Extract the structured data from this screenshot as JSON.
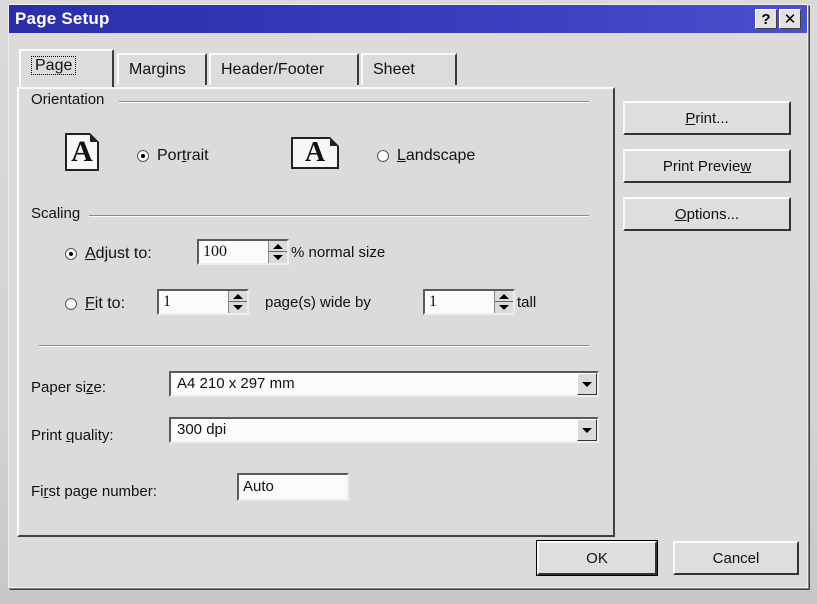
{
  "window": {
    "title": "Page Setup",
    "help_label": "?",
    "close_label": "✕"
  },
  "tabs": [
    {
      "label": "Page",
      "active": true
    },
    {
      "label": "Margins",
      "active": false
    },
    {
      "label": "Header/Footer",
      "active": false
    },
    {
      "label": "Sheet",
      "active": false
    }
  ],
  "orientation": {
    "group_label": "Orientation",
    "portrait_glyph": "A",
    "landscape_glyph": "A",
    "portrait": {
      "label_pre": "Por",
      "label_u": "t",
      "label_post": "rait",
      "checked": true
    },
    "landscape": {
      "label_pre": "",
      "label_u": "L",
      "label_post": "andscape",
      "checked": false
    }
  },
  "scaling": {
    "group_label": "Scaling",
    "adjust": {
      "label_pre": "",
      "label_u": "A",
      "label_post": "djust to:",
      "checked": true,
      "value": "100",
      "suffix": "% normal size"
    },
    "fit": {
      "label_pre": "",
      "label_u": "F",
      "label_post": "it to:",
      "checked": false,
      "wide_value": "1",
      "wide_suffix": "page(s) wide by",
      "tall_value": "1",
      "tall_suffix": "tall"
    }
  },
  "paper_size": {
    "label_pre": "Paper si",
    "label_u": "z",
    "label_post": "e:",
    "value": "A4 210 x 297 mm"
  },
  "print_quality": {
    "label_pre": "Print ",
    "label_u": "q",
    "label_post": "uality:",
    "value": "300 dpi"
  },
  "first_page": {
    "label_pre": "Fi",
    "label_u": "r",
    "label_post": "st page number:",
    "value": "Auto"
  },
  "side_buttons": {
    "print": {
      "pre": "",
      "u": "P",
      "post": "rint..."
    },
    "preview": {
      "pre": "Print Previe",
      "u": "w",
      "post": ""
    },
    "options": {
      "pre": "",
      "u": "O",
      "post": "ptions..."
    }
  },
  "footer_buttons": {
    "ok": "OK",
    "cancel": "Cancel"
  }
}
